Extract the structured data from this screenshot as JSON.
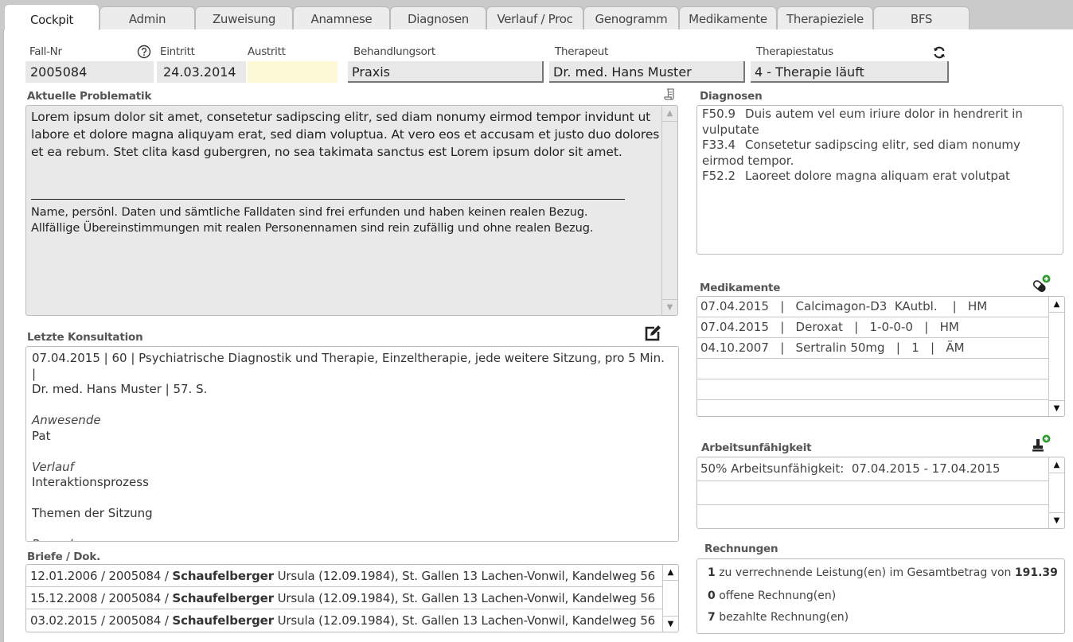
{
  "tabs": [
    {
      "label": "Cockpit",
      "active": true
    },
    {
      "label": "Admin"
    },
    {
      "label": "Zuweisung"
    },
    {
      "label": "Anamnese"
    },
    {
      "label": "Diagnosen"
    },
    {
      "label": "Verlauf / Proc"
    },
    {
      "label": "Genogramm"
    },
    {
      "label": "Medikamente"
    },
    {
      "label": "Therapieziele"
    },
    {
      "label": "BFS"
    }
  ],
  "header": {
    "fall_nr": {
      "label": "Fall-Nr",
      "value": "2005084"
    },
    "eintritt": {
      "label": "Eintritt",
      "value": "24.03.2014"
    },
    "austritt": {
      "label": "Austritt",
      "value": ""
    },
    "behandlungsort": {
      "label": "Behandlungsort",
      "value": "Praxis"
    },
    "therapeut": {
      "label": "Therapeut",
      "value": "Dr. med. Hans Muster"
    },
    "therapiestatus": {
      "label": "Therapiestatus",
      "value": "4 - Therapie läuft"
    },
    "help_icon": "question-circle-icon",
    "refresh_icon": "refresh-icon"
  },
  "problematik": {
    "title": "Aktuelle Problematik",
    "text": "Lorem ipsum dolor sit amet, consetetur sadipscing elitr, sed diam nonumy eirmod tempor invidunt ut labore et dolore magna aliquyam erat, sed diam voluptua. At vero eos et accusam et justo duo dolores et ea rebum. Stet clita kasd gubergren, no sea takimata sanctus est Lorem ipsum dolor sit amet.",
    "note_line1": "Name, persönl. Daten und sämtliche Falldaten sind frei erfunden und haben keinen realen Bezug.",
    "note_line2": "Allfällige Übereinstimmungen mit realen Personennamen sind rein zufällig und ohne realen Bezug.",
    "icon": "scroll-icon"
  },
  "diagnosen": {
    "title": "Diagnosen",
    "items": [
      {
        "code": "F50.9",
        "text": "Duis autem vel eum iriure dolor in hendrerit in vulputate"
      },
      {
        "code": "F33.4",
        "text": "Consetetur sadipscing elitr, sed diam nonumy eirmod tempor."
      },
      {
        "code": "F52.2",
        "text": "Laoreet dolore magna aliquam erat volutpat"
      }
    ]
  },
  "medikamente": {
    "title": "Medikamente",
    "icon": "add-pill-icon",
    "rows": [
      "07.04.2015   |   Calcimagon-D3  KAutbl.    |   HM",
      "07.04.2015   |   Deroxat   |   1-0-0-0   |   HM",
      "04.10.2007   |   Sertralin 50mg   |   1   |   ÄM",
      "",
      "",
      ""
    ]
  },
  "konsultation": {
    "title": "Letzte Konsultation",
    "icon": "edit-icon",
    "line1": "07.04.2015 | 60 | Psychiatrische Diagnostik und Therapie, Einzeltherapie, jede weitere Sitzung, pro 5 Min. |",
    "line2": "Dr. med. Hans Muster | 57. S.",
    "anwesende_label": "Anwesende",
    "anwesende": "Pat",
    "verlauf_label": "Verlauf",
    "verlauf": "Interaktionsprozess",
    "themen": "Themen der Sitzung",
    "procedere_label": "Procedere"
  },
  "arbeitsunfaehigkeit": {
    "title": "Arbeitsunfähigkeit",
    "icon": "add-stamp-icon",
    "rows": [
      "50% Arbeitsunfähigkeit:  07.04.2015 - 17.04.2015",
      "",
      ""
    ]
  },
  "briefe": {
    "title": "Briefe / Dok.",
    "rows": [
      {
        "prefix": "12.01.2006 / 2005084 / ",
        "name": "Schaufelberger",
        "suffix": " Ursula (12.09.1984), St. Gallen 13 Lachen-Vonwil, Kandelweg 56"
      },
      {
        "prefix": "15.12.2008 / 2005084 / ",
        "name": "Schaufelberger",
        "suffix": " Ursula (12.09.1984), St. Gallen 13 Lachen-Vonwil, Kandelweg 56"
      },
      {
        "prefix": "03.02.2015 / 2005084 / ",
        "name": "Schaufelberger",
        "suffix": " Ursula (12.09.1984), St. Gallen 13 Lachen-Vonwil, Kandelweg 56"
      }
    ]
  },
  "rechnungen": {
    "title": "Rechnungen",
    "line1": {
      "count": "1",
      "text": " zu verrechnende Leistung(en) im Gesamtbetrag von ",
      "amount": "191.39"
    },
    "line2": {
      "count": "0",
      "text": " offene Rechnung(en)"
    },
    "line3": {
      "count": "7",
      "text": " bezahlte Rechnung(en)"
    }
  },
  "colors": {
    "field_bg": "#e8e8e8",
    "austritt_bg": "#fdf9d6",
    "icon_green": "#2e9b2e"
  }
}
